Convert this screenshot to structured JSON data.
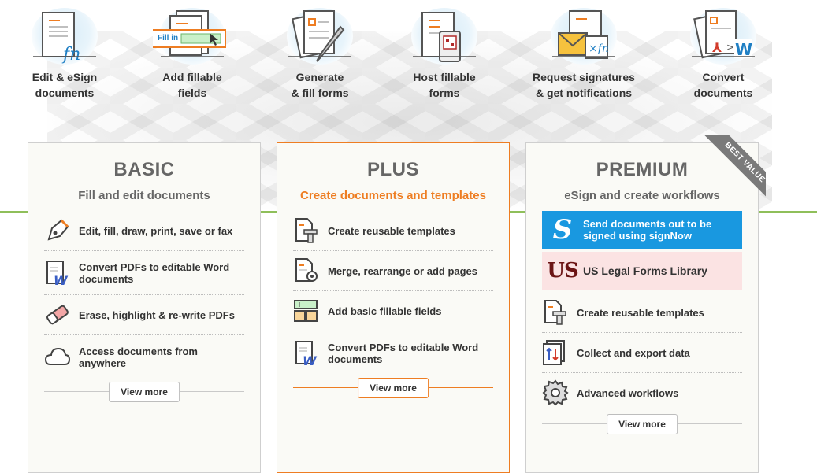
{
  "features": [
    {
      "label": "Edit & eSign\ndocuments",
      "icon": "esign-document-icon"
    },
    {
      "label": "Add fillable\nfields",
      "icon": "fillable-field-icon",
      "badge": "Fill in"
    },
    {
      "label": "Generate\n& fill forms",
      "icon": "generate-forms-icon"
    },
    {
      "label": "Host fillable\nforms",
      "icon": "host-forms-icon"
    },
    {
      "label": "Request signatures\n& get notifications",
      "icon": "request-signatures-icon"
    },
    {
      "label": "Convert\ndocuments",
      "icon": "convert-documents-icon"
    }
  ],
  "plans": {
    "basic": {
      "title": "BASIC",
      "subtitle": "Fill and edit documents",
      "items": [
        {
          "text": "Edit, fill, draw, print, save or fax",
          "icon": "pen-icon"
        },
        {
          "text": "Convert PDFs to editable Word documents",
          "icon": "word-document-icon"
        },
        {
          "text": "Erase, highlight & re-write PDFs",
          "icon": "eraser-icon"
        },
        {
          "text": "Access documents from anywhere",
          "icon": "cloud-icon"
        }
      ],
      "more": "View more"
    },
    "plus": {
      "title": "PLUS",
      "subtitle": "Create documents and templates",
      "items": [
        {
          "text": "Create reusable templates",
          "icon": "template-icon"
        },
        {
          "text": "Merge, rearrange or add pages",
          "icon": "document-gear-icon"
        },
        {
          "text": "Add basic fillable fields",
          "icon": "fields-grid-icon"
        },
        {
          "text": "Convert PDFs to editable Word documents",
          "icon": "word-document-icon"
        }
      ],
      "more": "View more"
    },
    "premium": {
      "title": "PREMIUM",
      "subtitle": "eSign and create workflows",
      "ribbon": "BEST VALUE",
      "signnow": "Send documents out to be signed using signNow",
      "signnow_logo": "S",
      "uslegal": "US Legal Forms Library",
      "uslegal_logo": "US",
      "items": [
        {
          "text": "Create reusable templates",
          "icon": "template-icon"
        },
        {
          "text": "Collect and export data",
          "icon": "collect-export-icon"
        },
        {
          "text": "Advanced workflows",
          "icon": "gear-icon"
        }
      ],
      "more": "View more"
    }
  },
  "colors": {
    "accent": "#ee7d22",
    "signnow": "#1998e0",
    "uslegal_bg": "#fbe3e3",
    "green_line": "#8fbf5a"
  }
}
